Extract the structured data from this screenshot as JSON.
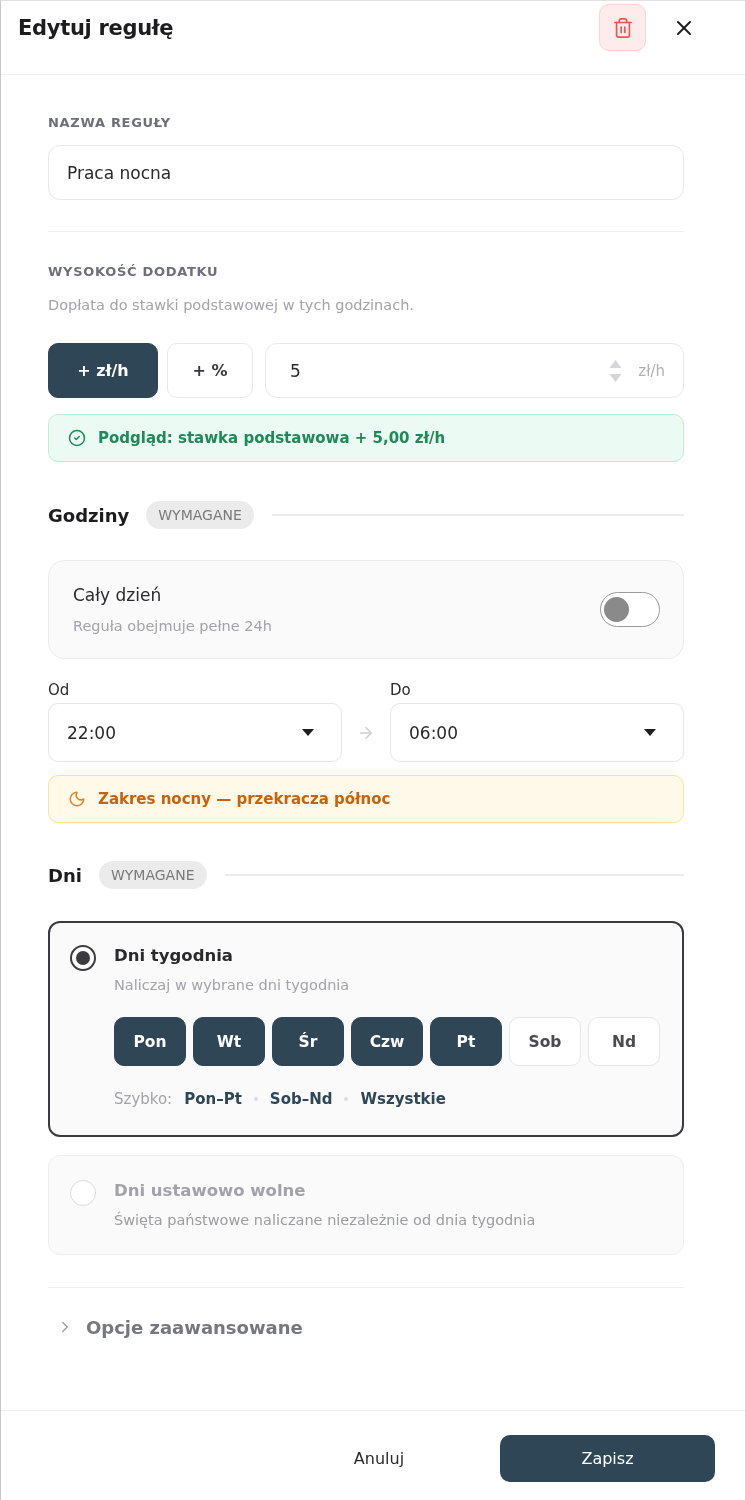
{
  "header": {
    "title": "Edytuj regułę"
  },
  "name_field": {
    "label": "NAZWA REGUŁY",
    "value": "Praca nocna"
  },
  "amount": {
    "label": "WYSOKOŚĆ DODATKU",
    "hint": "Dopłata do stawki podstawowej w tych godzinach.",
    "modes": [
      {
        "label": "+ zł/h",
        "selected": true
      },
      {
        "label": "+ %",
        "selected": false
      }
    ],
    "value": "5",
    "unit": "zł/h",
    "preview": "Podgląd: stawka podstawowa + 5,00 zł/h"
  },
  "hours": {
    "title": "Godziny",
    "badge": "WYMAGANE",
    "all_day": {
      "title": "Cały dzień",
      "subtitle": "Reguła obejmuje pełne 24h",
      "on": false
    },
    "from": {
      "label": "Od",
      "value": "22:00"
    },
    "to": {
      "label": "Do",
      "value": "06:00"
    },
    "notice": "Zakres nocny — przekracza północ"
  },
  "days": {
    "title": "Dni",
    "badge": "WYMAGANE",
    "options": [
      {
        "title": "Dni tygodnia",
        "subtitle": "Naliczaj w wybrane dni tygodnia",
        "selected": true,
        "disabled": false,
        "weekdays": [
          {
            "label": "Pon",
            "selected": true
          },
          {
            "label": "Wt",
            "selected": true
          },
          {
            "label": "Śr",
            "selected": true
          },
          {
            "label": "Czw",
            "selected": true
          },
          {
            "label": "Pt",
            "selected": true
          },
          {
            "label": "Sob",
            "selected": false
          },
          {
            "label": "Nd",
            "selected": false
          }
        ],
        "quick_label": "Szybko:",
        "quick": [
          "Pon–Pt",
          "Sob–Nd",
          "Wszystkie"
        ]
      },
      {
        "title": "Dni ustawowo wolne",
        "subtitle": "Święta państwowe naliczane niezależnie od dnia tygodnia",
        "selected": false,
        "disabled": true
      }
    ]
  },
  "advanced": {
    "label": "Opcje zaawansowane",
    "expanded": false
  },
  "footer": {
    "buttons": [
      {
        "label": "Anuluj",
        "kind": "secondary"
      },
      {
        "label": "Zapisz",
        "kind": "primary"
      }
    ]
  }
}
